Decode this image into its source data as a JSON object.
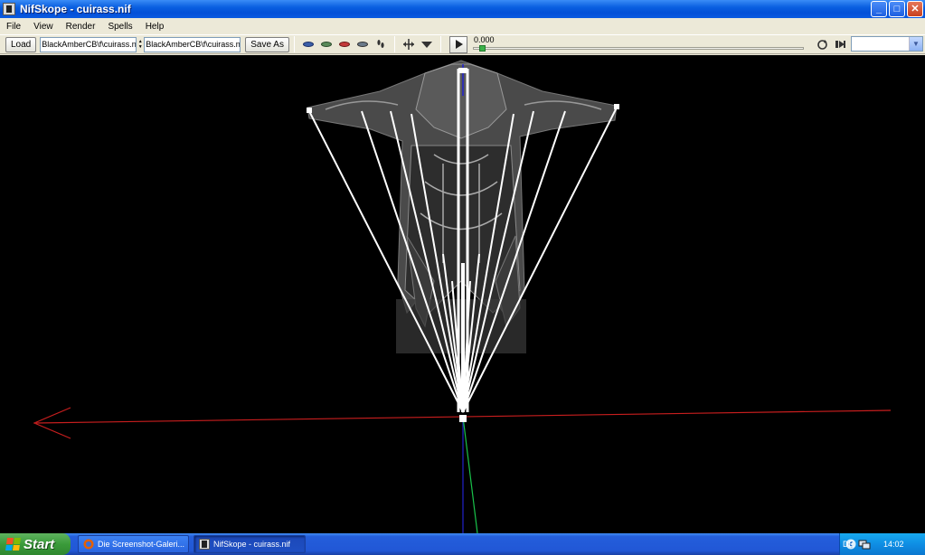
{
  "window": {
    "title": "NifSkope - cuirass.nif",
    "buttons": {
      "minimize": "_",
      "maximize": "□",
      "close": "✕"
    }
  },
  "menu": [
    "File",
    "View",
    "Render",
    "Spells",
    "Help"
  ],
  "toolbar": {
    "load_label": "Load",
    "load_path": "BlackAmberCB\\f\\cuirass.nif",
    "save_path": "BlackAmberCB\\f\\cuirass.nif",
    "save_as_label": "Save As",
    "time_value": "0.000",
    "timeline_progress": 0.02,
    "animation_select_value": ""
  },
  "icons": [
    "eye-icon",
    "eye-green-icon",
    "eye-red-icon",
    "eye-dim-icon",
    "footprints-icon",
    "move-icon",
    "down-arrow-icon",
    "play-icon",
    "loop-icon",
    "switch-icon"
  ],
  "colors": {
    "x_axis": "#c81e1e",
    "y_axis": "#19c24a",
    "z_axis": "#2222cc",
    "bones": "#ffffff"
  },
  "taskbar": {
    "start_label": "Start",
    "tasks": [
      {
        "label": "Die Screenshot-Galeri...",
        "active": false
      },
      {
        "label": "NifSkope - cuirass.nif",
        "active": true
      }
    ],
    "language": "DE",
    "clock": "14:02"
  }
}
